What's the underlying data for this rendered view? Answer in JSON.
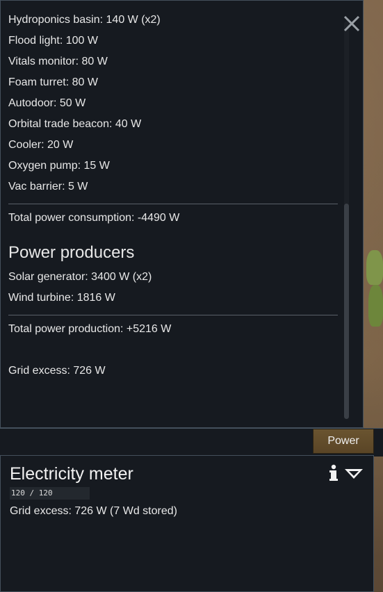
{
  "consumers": [
    "Hydroponics basin: 140 W (x2)",
    "Flood light: 100 W",
    "Vitals monitor: 80 W",
    "Foam turret: 80 W",
    "Autodoor: 50 W",
    "Orbital trade beacon: 40 W",
    "Cooler: 20 W",
    "Oxygen pump: 15 W",
    "Vac barrier: 5 W"
  ],
  "total_consumption": "Total power consumption: -4490 W",
  "producers_heading": "Power producers",
  "producers": [
    "Solar generator: 3400 W (x2)",
    "Wind turbine: 1816 W"
  ],
  "total_production": "Total power production: +5216 W",
  "grid_excess": "Grid excess: 726 W",
  "tab": {
    "label": "Power"
  },
  "inspect": {
    "title": "Electricity meter",
    "hitpoints": "120 / 120",
    "status": "Grid excess: 726 W (7 Wd stored)"
  },
  "icons": [
    "close-icon",
    "info-icon",
    "dropdown-menu-icon"
  ]
}
